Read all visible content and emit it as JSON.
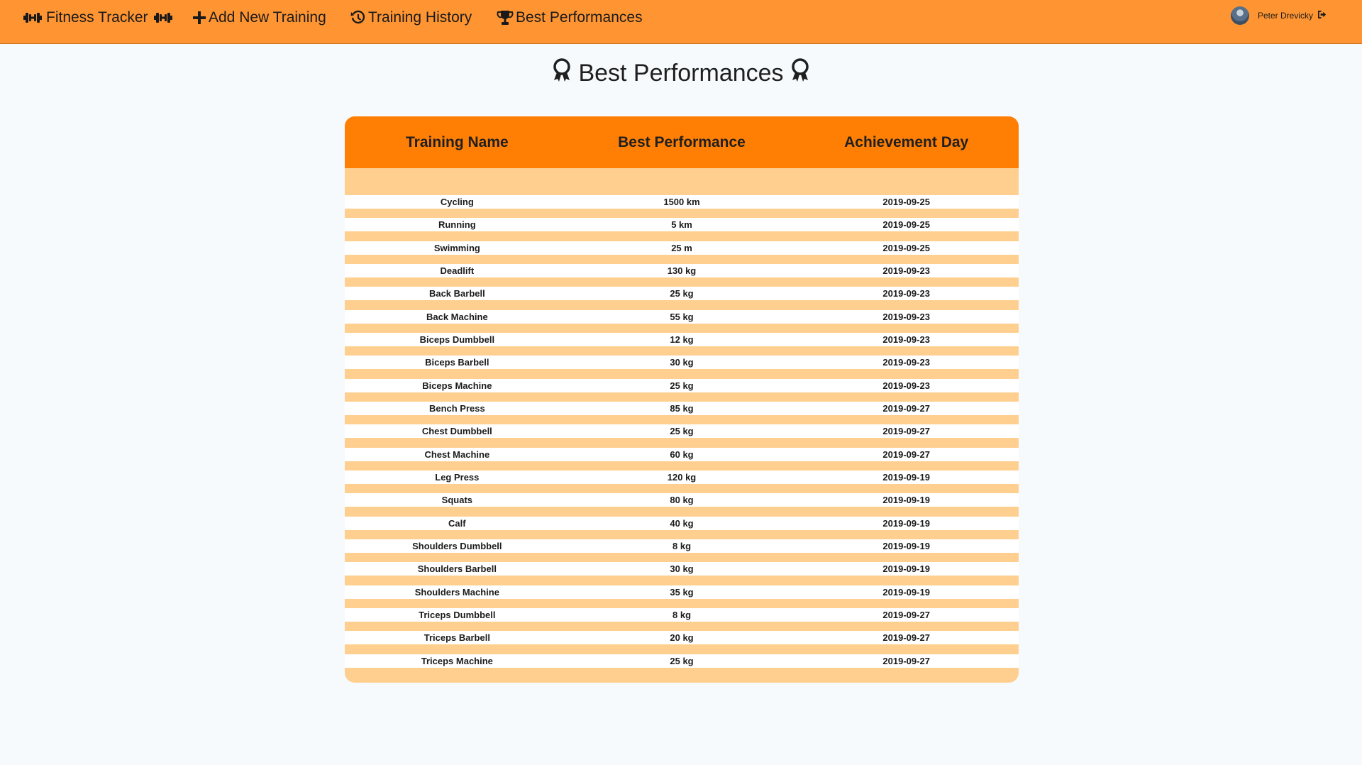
{
  "colors": {
    "navbar": "#ff9532",
    "table_header": "#ff7f05",
    "table_band": "#ffcf8f",
    "row": "#ffffff",
    "page_bg": "#f6fafd"
  },
  "navbar": {
    "brand": "Fitness Tracker",
    "brand_icons": [
      "dumbbell-icon",
      "dumbbell-icon"
    ],
    "links": [
      {
        "label": "Add New Training",
        "icon": "plus-icon"
      },
      {
        "label": "Training History",
        "icon": "history-icon"
      },
      {
        "label": "Best Performances",
        "icon": "trophy-icon"
      }
    ],
    "user": {
      "name": "Peter Drevicky",
      "avatar": "avatar-photo",
      "logout_icon": "logout-icon"
    }
  },
  "page": {
    "title": "Best Performances",
    "title_icons": [
      "award-icon",
      "award-icon"
    ]
  },
  "table": {
    "columns": [
      "Training Name",
      "Best Performance",
      "Achievement Day"
    ],
    "rows": [
      {
        "name": "Cycling",
        "performance": "1500 km",
        "day": "2019-09-25"
      },
      {
        "name": "Running",
        "performance": "5 km",
        "day": "2019-09-25"
      },
      {
        "name": "Swimming",
        "performance": "25 m",
        "day": "2019-09-25"
      },
      {
        "name": "Deadlift",
        "performance": "130 kg",
        "day": "2019-09-23"
      },
      {
        "name": "Back Barbell",
        "performance": "25 kg",
        "day": "2019-09-23"
      },
      {
        "name": "Back Machine",
        "performance": "55 kg",
        "day": "2019-09-23"
      },
      {
        "name": "Biceps Dumbbell",
        "performance": "12 kg",
        "day": "2019-09-23"
      },
      {
        "name": "Biceps Barbell",
        "performance": "30 kg",
        "day": "2019-09-23"
      },
      {
        "name": "Biceps Machine",
        "performance": "25 kg",
        "day": "2019-09-23"
      },
      {
        "name": "Bench Press",
        "performance": "85 kg",
        "day": "2019-09-27"
      },
      {
        "name": "Chest Dumbbell",
        "performance": "25 kg",
        "day": "2019-09-27"
      },
      {
        "name": "Chest Machine",
        "performance": "60 kg",
        "day": "2019-09-27"
      },
      {
        "name": "Leg Press",
        "performance": "120 kg",
        "day": "2019-09-19"
      },
      {
        "name": "Squats",
        "performance": "80 kg",
        "day": "2019-09-19"
      },
      {
        "name": "Calf",
        "performance": "40 kg",
        "day": "2019-09-19"
      },
      {
        "name": "Shoulders Dumbbell",
        "performance": "8 kg",
        "day": "2019-09-19"
      },
      {
        "name": "Shoulders Barbell",
        "performance": "30 kg",
        "day": "2019-09-19"
      },
      {
        "name": "Shoulders Machine",
        "performance": "35 kg",
        "day": "2019-09-19"
      },
      {
        "name": "Triceps Dumbbell",
        "performance": "8 kg",
        "day": "2019-09-27"
      },
      {
        "name": "Triceps Barbell",
        "performance": "20 kg",
        "day": "2019-09-27"
      },
      {
        "name": "Triceps Machine",
        "performance": "25 kg",
        "day": "2019-09-27"
      }
    ]
  }
}
